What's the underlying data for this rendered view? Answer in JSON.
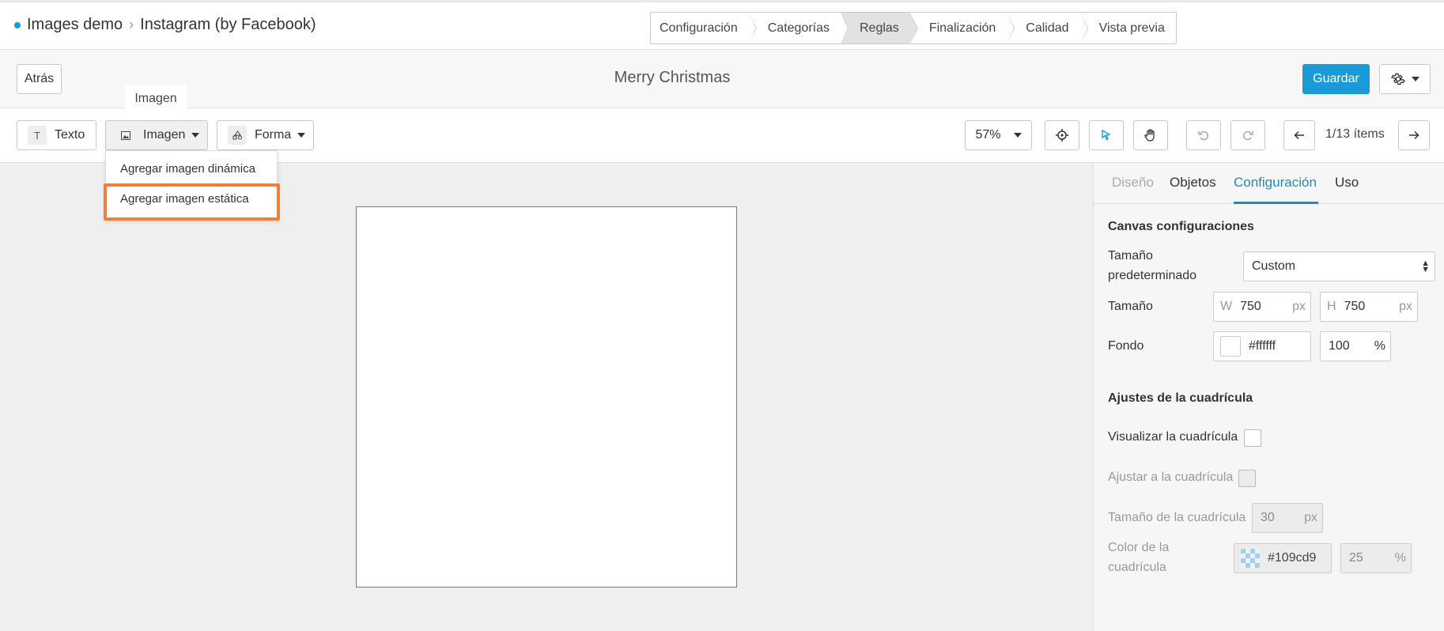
{
  "breadcrumb": {
    "root": "Images demo",
    "current": "Instagram (by Facebook)"
  },
  "steps": [
    {
      "label": "Configuración",
      "active": false
    },
    {
      "label": "Categorías",
      "active": false
    },
    {
      "label": "Reglas",
      "active": true
    },
    {
      "label": "Finalización",
      "active": false
    },
    {
      "label": "Calidad",
      "active": false
    },
    {
      "label": "Vista previa",
      "active": false
    }
  ],
  "bar": {
    "back_label": "Atrás",
    "title": "Merry Christmas",
    "save_label": "Guardar"
  },
  "tooltip": {
    "text": "Imagen"
  },
  "toolbar": {
    "text_label": "Texto",
    "image_label": "Imagen",
    "shape_label": "Forma",
    "zoom": "57%",
    "items_count": "1/13 ítems"
  },
  "dropdown": {
    "items": [
      "Agregar imagen dinámica",
      "Agregar imagen estática"
    ],
    "highlight_color": "#f07f3c"
  },
  "panel": {
    "tabs": [
      {
        "label": "Diseño"
      },
      {
        "label": "Objetos"
      },
      {
        "label": "Configuración"
      },
      {
        "label": "Uso"
      }
    ],
    "canvas_section": "Canvas configuraciones",
    "preset_label": "Tamaño predeterminado",
    "preset_value": "Custom",
    "size_label": "Tamaño",
    "width_prefix": "W",
    "width_value": "750",
    "height_prefix": "H",
    "height_value": "750",
    "unit_px": "px",
    "bg_label": "Fondo",
    "bg_color": "#ffffff",
    "bg_opacity": "100",
    "unit_pct": "%",
    "grid_section": "Ajustes de la cuadrícula",
    "show_grid_label": "Visualizar la cuadrícula",
    "snap_grid_label": "Ajustar a la cuadrícula",
    "grid_size_label": "Tamaño de la cuadrícula",
    "grid_size_value": "30",
    "grid_color_label": "Color de la cuadrícula",
    "grid_color_value": "#109cd9",
    "grid_opacity_value": "25"
  },
  "colors": {
    "accent": "#1a9bd7",
    "active_tab": "#1a8ccb"
  }
}
